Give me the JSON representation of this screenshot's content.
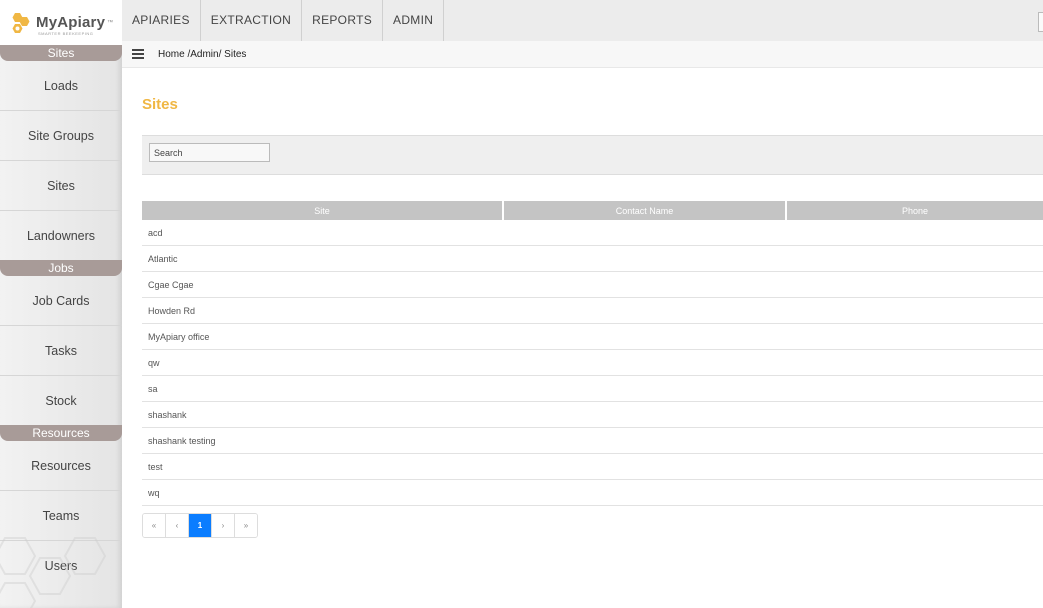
{
  "brand": {
    "name": "MyApiary",
    "tm": "™",
    "tagline": "SMARTER BEEKEEPING"
  },
  "topnav": [
    "APIARIES",
    "EXTRACTION",
    "REPORTS",
    "ADMIN"
  ],
  "breadcrumb": {
    "home": "Home",
    "sep1": "/",
    "admin": "Admin",
    "sep2": "/",
    "current": "Sites"
  },
  "sidebar": {
    "sections": [
      {
        "header": "Sites",
        "items": [
          "Loads",
          "Site Groups",
          "Sites",
          "Landowners"
        ]
      },
      {
        "header": "Jobs",
        "items": [
          "Job Cards",
          "Tasks",
          "Stock"
        ]
      },
      {
        "header": "Resources",
        "items": [
          "Resources",
          "Teams",
          "Users"
        ]
      }
    ]
  },
  "page": {
    "title": "Sites"
  },
  "search": {
    "placeholder": "Search"
  },
  "table": {
    "columns": [
      "Site",
      "Contact Name",
      "Phone"
    ],
    "rows": [
      "acd",
      "Atlantic",
      "Cgae Cgae",
      "Howden Rd",
      "MyApiary office",
      "qw",
      "sa",
      "shashank",
      "shashank testing",
      "test",
      "wq"
    ]
  },
  "pagination": {
    "first": "«",
    "prev": "‹",
    "current": "1",
    "next": "›",
    "last": "»"
  },
  "colors": {
    "accent": "#f0b744",
    "section": "#a89b98",
    "active_page": "#0b7dff"
  }
}
